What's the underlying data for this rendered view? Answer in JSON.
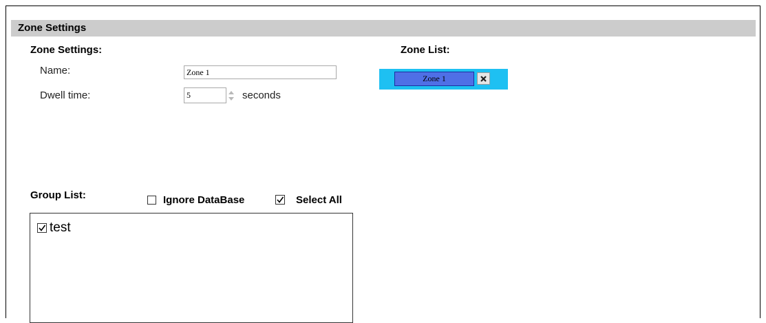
{
  "header": {
    "title": "Zone Settings"
  },
  "zone_settings": {
    "title": "Zone Settings:",
    "name_label": "Name:",
    "name_value": "Zone 1",
    "dwell_label": "Dwell time:",
    "dwell_value": "5",
    "dwell_unit": "seconds"
  },
  "zone_list": {
    "title": "Zone List:",
    "zones": [
      {
        "label": "Zone 1"
      }
    ],
    "accent_color": "#1ec0f2",
    "chip_color": "#4f6fe6"
  },
  "group_list": {
    "title": "Group List:",
    "ignore_database_label": "Ignore DataBase",
    "ignore_database_checked": false,
    "select_all_label": "Select All",
    "select_all_checked": true,
    "items": [
      {
        "label": "test",
        "checked": true
      }
    ]
  }
}
